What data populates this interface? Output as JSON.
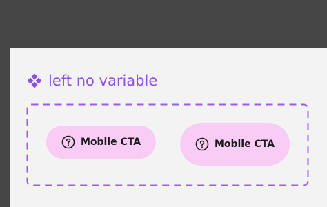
{
  "component_set": {
    "title": "left no variable",
    "icon": "component-set-icon",
    "accent_color": "#8f4fe3"
  },
  "variants": [
    {
      "label": "Mobile CTA",
      "icon": "help-circle-icon",
      "background": "#f9ccf6"
    },
    {
      "label": "Mobile CTA",
      "icon": "help-circle-icon",
      "background": "#f9ccf6"
    }
  ]
}
